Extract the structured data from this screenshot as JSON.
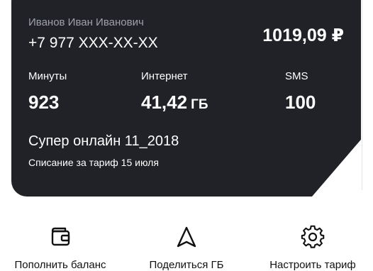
{
  "account": {
    "owner_name": "Иванов Иван Иванович",
    "phone": "+7 977 XXX-XX-XX",
    "balance": "1019,09 ₽"
  },
  "remains": [
    {
      "label": "Минуты",
      "value": "923",
      "unit": ""
    },
    {
      "label": "Интернет",
      "value": "41,42",
      "unit": "ГБ"
    },
    {
      "label": "SMS",
      "value": "100",
      "unit": ""
    }
  ],
  "tariff": {
    "name": "Супер онлайн 11_2018",
    "charge_text": "Списание за тариф 15 июля"
  },
  "actions": [
    {
      "label": "Пополнить баланс",
      "icon": "wallet-icon"
    },
    {
      "label": "Поделиться ГБ",
      "icon": "navigation-arrow-icon"
    },
    {
      "label": "Настроить тариф",
      "icon": "gear-icon"
    }
  ],
  "colors": {
    "card_bg": "#202228",
    "muted_text": "#9ea1a8"
  }
}
